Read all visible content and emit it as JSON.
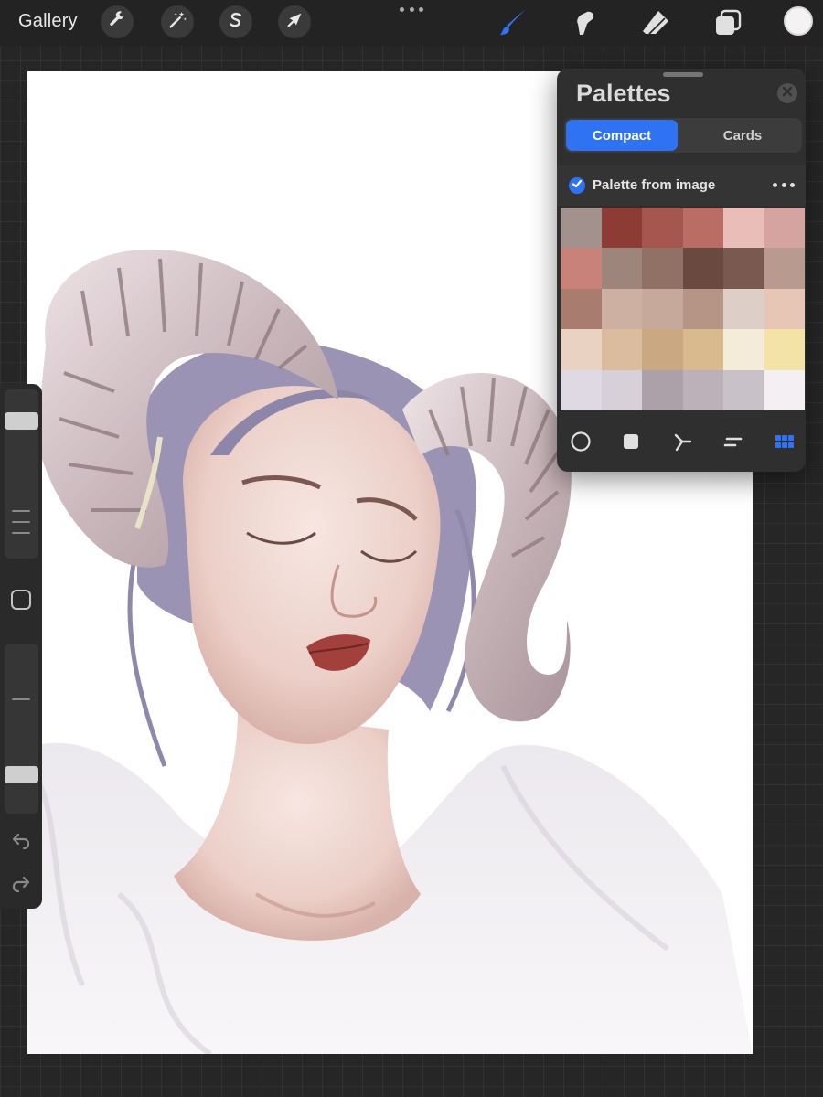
{
  "toolbar": {
    "gallery_label": "Gallery",
    "left_tools": [
      {
        "icon": "wrench-icon",
        "name": "actions"
      },
      {
        "icon": "magic-wand-icon",
        "name": "adjustments"
      },
      {
        "icon": "selection-s-icon",
        "name": "selection"
      },
      {
        "icon": "arrow-cursor-icon",
        "name": "transform"
      }
    ],
    "right_tools": [
      {
        "icon": "brush-icon",
        "name": "paint",
        "active": true,
        "color": "#2f73f3"
      },
      {
        "icon": "smudge-icon",
        "name": "smudge",
        "active": false
      },
      {
        "icon": "eraser-icon",
        "name": "erase",
        "active": false
      },
      {
        "icon": "layers-icon",
        "name": "layers",
        "active": false
      }
    ],
    "current_color": "#f4f2f3"
  },
  "sidebar": {
    "brush_size_level": 0.85,
    "opacity_level": 0.2,
    "icons": [
      "modify-square-icon",
      "undo-icon",
      "redo-icon"
    ]
  },
  "palettes": {
    "title": "Palettes",
    "view_tabs": [
      {
        "label": "Compact",
        "active": true
      },
      {
        "label": "Cards",
        "active": false
      }
    ],
    "palette": {
      "name": "Palette from image",
      "default": true,
      "swatches": [
        "#a2918d",
        "#8c3b35",
        "#a5564f",
        "#b96d65",
        "#e9bdb8",
        "#d5a3a0",
        "#c8827a",
        "#9d857c",
        "#917065",
        "#6a4a40",
        "#7a5a50",
        "#b89a8e",
        "#a87c6f",
        "#ceb0a3",
        "#c7a99c",
        "#b69486",
        "#ddcec7",
        "#e8c6b6",
        "#e9d2c2",
        "#dcbc9e",
        "#c9a882",
        "#d9b98e",
        "#f4ebd8",
        "#f4e3a6",
        "#dfd9e4",
        "#d8d0d9",
        "#aca1a8",
        "#bcb1b8",
        "#c9c1c8",
        "#f4eff2"
      ]
    },
    "bottom_tabs": [
      {
        "icon": "disc-icon",
        "name": "disc",
        "active": false
      },
      {
        "icon": "square-icon",
        "name": "classic",
        "active": false
      },
      {
        "icon": "harmony-icon",
        "name": "harmony",
        "active": false
      },
      {
        "icon": "value-icon",
        "name": "value",
        "active": false
      },
      {
        "icon": "palettes-grid-icon",
        "name": "palettes",
        "active": true
      }
    ],
    "accent": "#2f73f3"
  },
  "colors": {
    "background": "#262626",
    "panel": "#2f2f2f",
    "accent": "#2f73f3"
  }
}
